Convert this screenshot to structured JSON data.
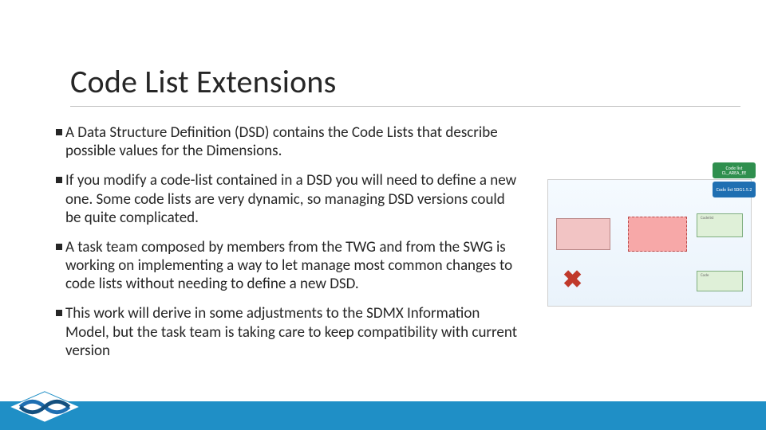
{
  "title": "Code List Extensions",
  "bullets": [
    "A Data Structure Definition (DSD) contains the Code Lists that describe possible values for the Dimensions.",
    "If you modify a code-list contained in a DSD you will need to define a new one. Some code lists are very dynamic, so managing DSD versions could be quite complicated.",
    "A task team composed by members from the TWG and from the SWG is working on implementing a way to let manage most common changes to code lists without needing to define a new DSD.",
    "This work will derive in some adjustments to the SDMX Information Model, but the task team is taking care to keep compatibility with current version"
  ],
  "diagram": {
    "tag1": "Code list CL_AREA_EE",
    "tag2": "Code list SDG1.5.2",
    "box3": "Codelist",
    "box4": "Code"
  }
}
